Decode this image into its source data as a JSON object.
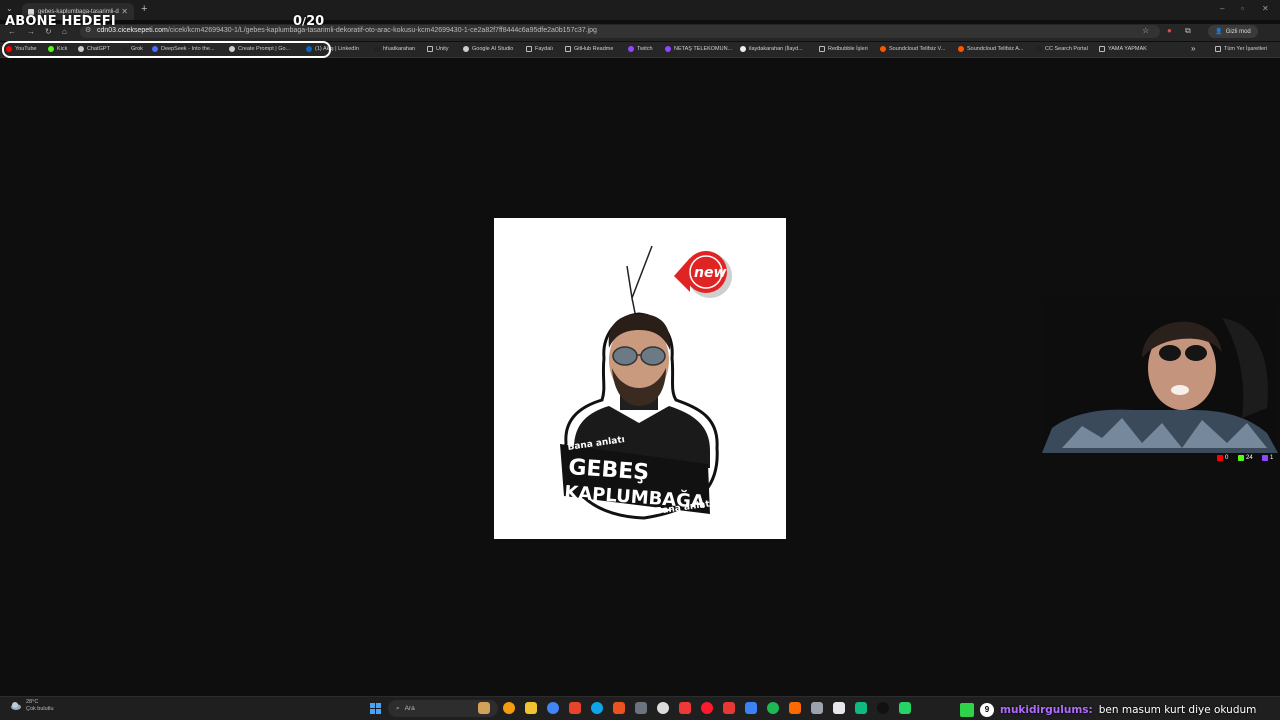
{
  "stream_overlay": {
    "goal_title": "ABONE HEDEFI",
    "goal_current": "0",
    "goal_sep": "/",
    "goal_target": "20"
  },
  "browser": {
    "tab_title": "gebes-kaplumbaga-tasarimli-d",
    "url_host": "cdn03.ciceksepeti.com",
    "url_path": "/cicek/kcm42699430-1/L/gebes-kaplumbaga-tasarimli-dekoratif-oto-arac-kokusu-kcm42699430-1-ce2a82f7ff8444c6a95dfe2a0b157c37.jpg",
    "incognito_label": "Gizli mod",
    "all_bookmarks": "Tüm Yer İşaretleri"
  },
  "bookmarks": [
    {
      "label": "YouTube",
      "color": "#ff0000"
    },
    {
      "label": "Kick",
      "color": "#53fc18"
    },
    {
      "label": "ChatGPT",
      "color": "#cccccc"
    },
    {
      "label": "Grok",
      "color": "#222222"
    },
    {
      "label": "DeepSeek - Into the...",
      "color": "#4d6bfe"
    },
    {
      "label": "Create Prompt | Go...",
      "color": "#cccccc"
    },
    {
      "label": "(1) Akış | LinkedIn",
      "color": "#0a66c2"
    },
    {
      "label": "hfuatkarahan",
      "color": "#222222"
    },
    {
      "label": "Unity",
      "color": "folder"
    },
    {
      "label": "Google AI Studio",
      "color": "#cccccc"
    },
    {
      "label": "Faydalı",
      "color": "folder"
    },
    {
      "label": "GitHub Readme",
      "color": "folder"
    },
    {
      "label": "Twitch",
      "color": "#9146ff"
    },
    {
      "label": "NETAŞ TELEKOMUN...",
      "color": "#9146ff"
    },
    {
      "label": "ilaydakarahan (İlayd...",
      "color": "#eeeeee"
    },
    {
      "label": "Redbubble İşleri",
      "color": "folder"
    },
    {
      "label": "Soundcloud Telifsiz V...",
      "color": "#ff5500"
    },
    {
      "label": "Soundcloud Telifsiz A...",
      "color": "#ff5500"
    },
    {
      "label": "CC Search Portal",
      "color": "#222222"
    },
    {
      "label": "YAMA YAPMAK",
      "color": "folder"
    }
  ],
  "product_image": {
    "badge_text": "new",
    "sticker_small_top": "Bana anlatı",
    "sticker_line1": "GEBEŞ",
    "sticker_line2": "KAPLUMBAĞA",
    "sticker_small_bottom": "Bana anlatı"
  },
  "stream_stats": {
    "youtube": "0",
    "kick": "24",
    "twitch": "1"
  },
  "taskbar": {
    "temperature": "28°C",
    "weather": "Çok bulutlu",
    "search_placeholder": "Ara"
  },
  "chat": {
    "badge": "9",
    "username": "mukidirgulums:",
    "message": "ben masum kurt diye okudum"
  }
}
